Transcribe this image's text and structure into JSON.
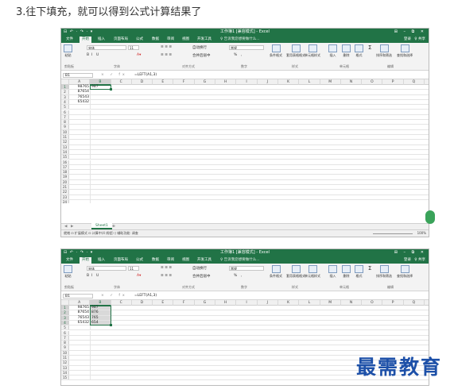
{
  "heading": "3.往下填充，就可以得到公式计算结果了",
  "window_title": "工作簿1 [兼容模式] - Excel",
  "qat": "⊟ ↶ · ↷ · ▾",
  "window_controls": "⊞ – ⧉ ✕",
  "tabs": [
    "文件",
    "开始",
    "插入",
    "页面布局",
    "公式",
    "数据",
    "审阅",
    "视图",
    "开发工具"
  ],
  "active_tab": "开始",
  "tell_me": "♀ 告诉我您想要做什么...",
  "signin": "登录",
  "share": "♀ 共享",
  "ribbon": {
    "paste": "粘贴",
    "font_name": "宋体",
    "font_size": "11",
    "bold": "B",
    "italic": "I",
    "underline": "U",
    "wrap": "自动换行",
    "merge": "合并后居中",
    "number_format": "常规",
    "percent": "%",
    "comma": ",",
    "cond_format": "条件格式",
    "table_format": "套用表格格式",
    "cell_styles": "单元格样式",
    "insert": "插入",
    "delete": "删除",
    "format": "格式",
    "sort_filter": "排序和筛选",
    "find_select": "查找和选择",
    "groups": [
      "剪贴板",
      "字体",
      "对齐方式",
      "数字",
      "样式",
      "单元格",
      "编辑"
    ]
  },
  "formula_bar": {
    "namebox": "B1",
    "icons": "× ✓ fx",
    "formula": "=LEFT(A1,3)"
  },
  "columns": [
    "A",
    "B",
    "C",
    "D",
    "E",
    "F",
    "G",
    "H",
    "I",
    "J",
    "K",
    "L",
    "M",
    "N",
    "O",
    "P",
    "Q"
  ],
  "shot1": {
    "rows": [
      "1",
      "2",
      "3",
      "4",
      "5",
      "6",
      "7",
      "8",
      "9",
      "10",
      "11",
      "12",
      "13",
      "14",
      "15",
      "16",
      "17",
      "18",
      "19",
      "20",
      "21",
      "22",
      "23",
      "24"
    ],
    "a_values": [
      "98765",
      "87654",
      "76543",
      "65432"
    ],
    "b_values": [
      "987"
    ],
    "sheet_tab": "Sheet1",
    "status_left": "就绪   ⊡ 扩展模式  ⊡ 计算中(4 线程) ◊ 辅助功能: 调查",
    "zoom": "100%"
  },
  "shot2": {
    "rows": [
      "1",
      "2",
      "3",
      "4",
      "5",
      "6",
      "7",
      "8",
      "9",
      "10",
      "11",
      "12",
      "13",
      "14",
      "15"
    ],
    "a_values": [
      "98765",
      "87654",
      "76543",
      "65432"
    ],
    "b_values": [
      "987",
      "876",
      "765",
      "654"
    ]
  },
  "watermark": "最需教育",
  "colors": {
    "excel_green": "#217346",
    "watermark_blue": "#1d50a8"
  }
}
